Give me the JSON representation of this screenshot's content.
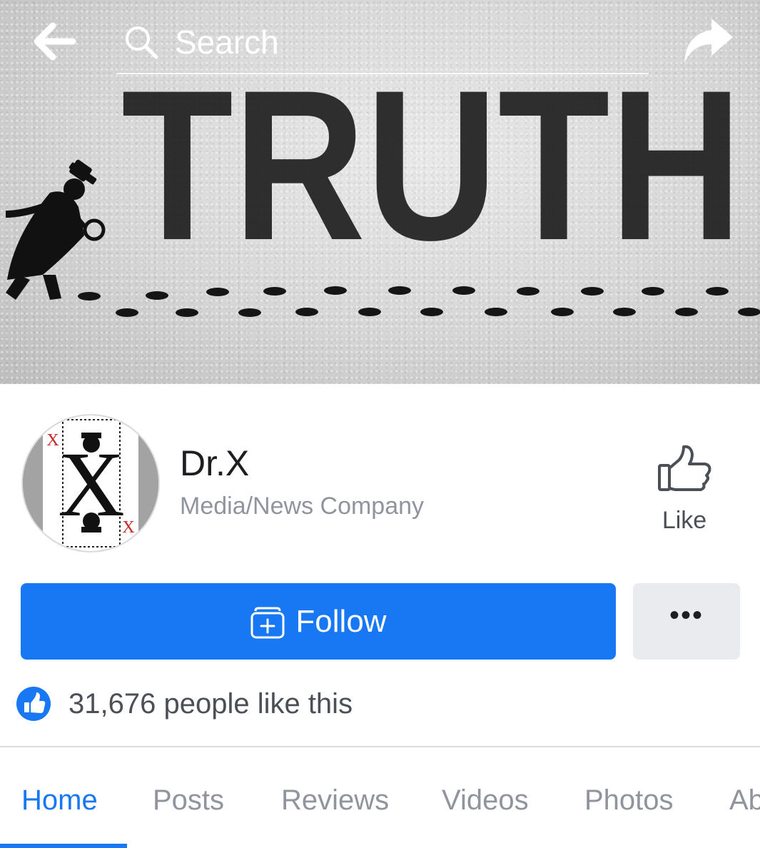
{
  "header": {
    "search_placeholder": "Search",
    "back_icon": "arrow-left-icon",
    "search_icon": "search-icon",
    "share_icon": "share-arrow-icon"
  },
  "cover": {
    "text": "TRUTH"
  },
  "profile": {
    "name": "Dr.X",
    "category": "Media/News Company",
    "avatar_letters": "X"
  },
  "actions": {
    "like_label": "Like",
    "like_icon": "thumbs-up-icon",
    "follow_label": "Follow",
    "follow_icon": "follow-plus-icon",
    "more_label": "•••"
  },
  "likes": {
    "text": "31,676 people like this",
    "icon": "like-badge-icon"
  },
  "tabs": [
    {
      "label": "Home",
      "active": true
    },
    {
      "label": "Posts",
      "active": false
    },
    {
      "label": "Reviews",
      "active": false
    },
    {
      "label": "Videos",
      "active": false
    },
    {
      "label": "Photos",
      "active": false
    },
    {
      "label": "About",
      "active": false
    }
  ],
  "colors": {
    "accent": "#1877f2",
    "more_bg": "#e9ebee",
    "text_primary": "#1c1e21",
    "text_secondary": "#90949c"
  }
}
